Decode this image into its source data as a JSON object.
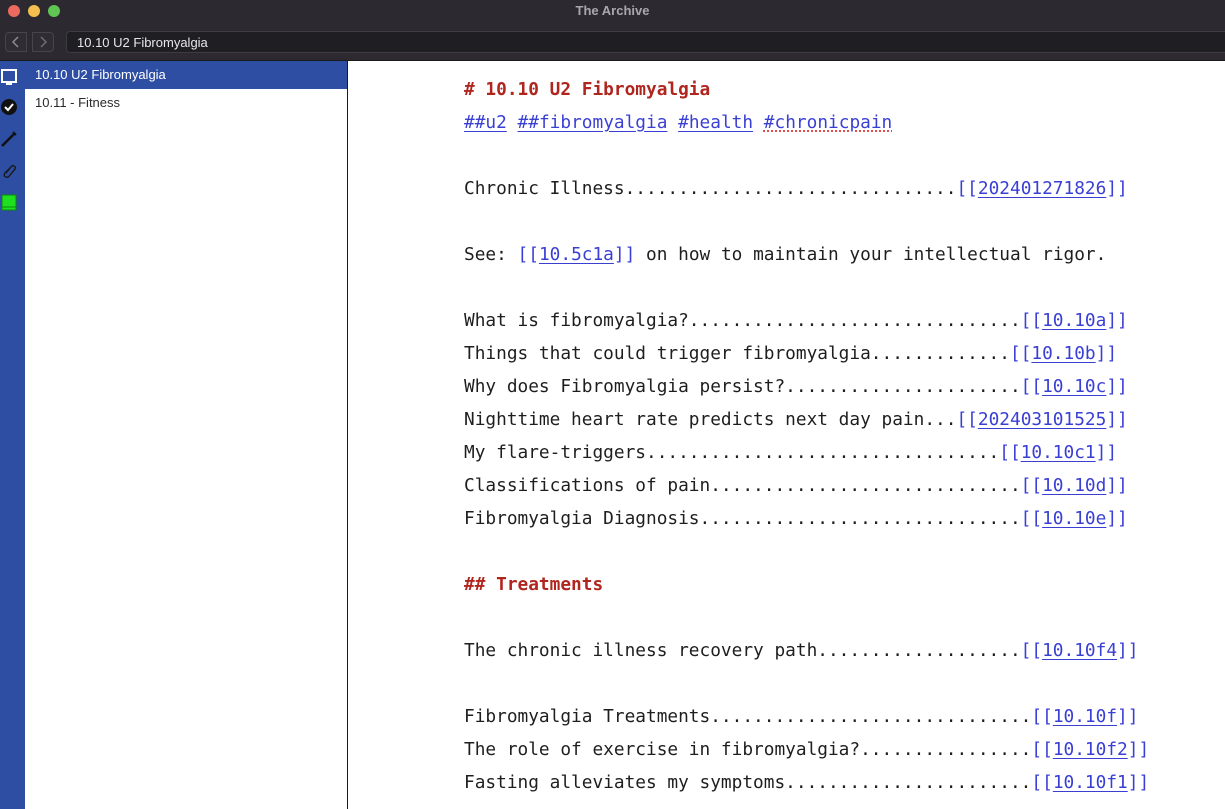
{
  "window": {
    "title": "The Archive"
  },
  "toolbar": {
    "back_icon": "chevron-left-icon",
    "forward_icon": "chevron-right-icon",
    "search_value": "10.10 U2 Fibromyalgia"
  },
  "rail": {
    "icons": [
      "notes-icon",
      "checkmark-icon",
      "wand-icon",
      "paperclip-icon",
      "book-icon"
    ],
    "active_color": "#2d4ea3",
    "book_color": "#1fe01f"
  },
  "note_list": {
    "items": [
      {
        "label": "10.10 U2 Fibromyalgia",
        "selected": true
      },
      {
        "label": "10.11 - Fitness",
        "selected": false
      }
    ]
  },
  "editor": {
    "title": "# 10.10 U2 Fibromyalgia",
    "tags": [
      "##u2",
      "##fibromyalgia",
      "#health",
      "#chronicpain"
    ],
    "chronic_illness": {
      "text": "Chronic Illness...............................",
      "link": "202401271826"
    },
    "see": {
      "prefix": "See: ",
      "link": "10.5c1a",
      "suffix": " on how to maintain your intellectual rigor."
    },
    "links1": [
      {
        "text": "What is fibromyalgia?...............................",
        "link": "10.10a"
      },
      {
        "text": "Things that could trigger fibromyalgia.............",
        "link": "10.10b"
      },
      {
        "text": "Why does Fibromyalgia persist?......................",
        "link": "10.10c"
      },
      {
        "text": "Nighttime heart rate predicts next day pain...",
        "link": "202403101525"
      },
      {
        "text": "My flare-triggers.................................",
        "link": "10.10c1"
      },
      {
        "text": "Classifications of pain.............................",
        "link": "10.10d"
      },
      {
        "text": "Fibromyalgia Diagnosis..............................",
        "link": "10.10e"
      }
    ],
    "treatments_heading": "## Treatments",
    "recovery": {
      "text": "The chronic illness recovery path...................",
      "link": "10.10f4"
    },
    "links2": [
      {
        "text": "Fibromyalgia Treatments..............................",
        "link": "10.10f"
      },
      {
        "text": "The role of exercise in fibromyalgia?................",
        "link": "10.10f2"
      },
      {
        "text": "Fasting alleviates my symptoms.......................",
        "link": "10.10f1"
      }
    ],
    "colors": {
      "heading": "#b0261f",
      "link": "#3a3fd4"
    }
  }
}
